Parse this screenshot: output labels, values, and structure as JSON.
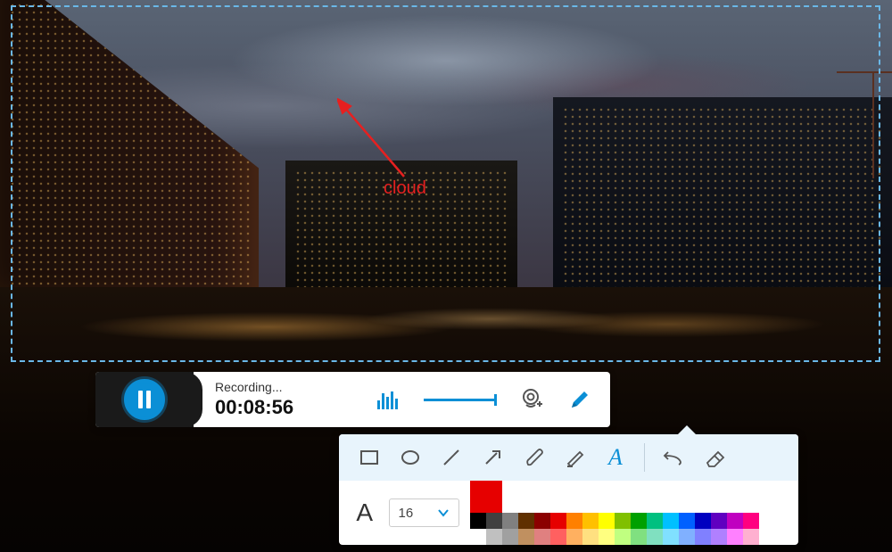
{
  "annotation": {
    "label": "cloud",
    "color": "#e62020"
  },
  "recorder": {
    "status": "Recording...",
    "time": "00:08:56"
  },
  "text_tool": {
    "font_size": "16"
  },
  "palette": {
    "current": "#e60000",
    "row1": [
      "#000000",
      "#404040",
      "#808080",
      "#603000",
      "#8b0000",
      "#e60000",
      "#ff8000",
      "#ffc000",
      "#ffff00",
      "#80c000",
      "#00a000",
      "#00c080",
      "#00c0ff",
      "#0060ff",
      "#0000c0",
      "#6000c0",
      "#c000c0",
      "#ff0080"
    ],
    "row2": [
      "#ffffff",
      "#c0c0c0",
      "#a0a0a0",
      "#c09060",
      "#e08080",
      "#ff6060",
      "#ffb060",
      "#ffe080",
      "#ffff80",
      "#c0ff80",
      "#80e080",
      "#80e0c0",
      "#80e0ff",
      "#80b0ff",
      "#8080ff",
      "#b080ff",
      "#ff80ff",
      "#ffb0d0"
    ]
  },
  "icons": {
    "pause": "pause",
    "audio_level": "audio-bars",
    "volume_slider": "volume",
    "webcam": "webcam",
    "pencil": "pencil",
    "rect": "rectangle",
    "ellipse": "ellipse",
    "line": "line",
    "arrow": "arrow",
    "brush": "brush",
    "highlighter": "highlighter",
    "text": "text",
    "undo": "undo",
    "eraser": "eraser",
    "font_sample": "A",
    "chevron": "chevron-down"
  }
}
